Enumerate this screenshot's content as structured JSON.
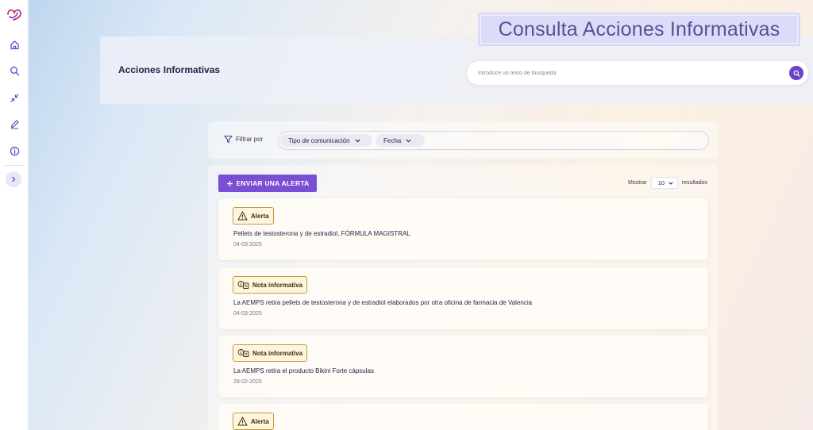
{
  "app": {
    "title": "Consulta Acciones Informativas"
  },
  "sidebar": {
    "items": [
      {
        "name": "home",
        "icon": "home-icon"
      },
      {
        "name": "search",
        "icon": "search-icon"
      },
      {
        "name": "collapse",
        "icon": "minimize-arrows-icon"
      },
      {
        "name": "edit",
        "icon": "pencil-icon"
      },
      {
        "name": "info",
        "icon": "info-icon"
      }
    ],
    "expand_icon": "chevron-right-icon"
  },
  "header": {
    "page_title": "Acciones Informativas",
    "search": {
      "placeholder": "Introduce un texto de busqueda",
      "value": ""
    }
  },
  "filters": {
    "label": "Filtrar por",
    "chips": [
      {
        "label": "Tipo de comunicación"
      },
      {
        "label": "Fecha"
      }
    ]
  },
  "toolbar": {
    "send_label": "ENVIAR UNA ALERTA",
    "show_label": "Mostrar",
    "show_value": "10",
    "results_label": "resultados"
  },
  "items": [
    {
      "type": "Alerta",
      "icon": "warning-triangle-icon",
      "title": "Pellets de testosterona y de estradiol, FÓRMULA MAGISTRAL",
      "date": "04-03-2025"
    },
    {
      "type": "Nota informativa",
      "icon": "info-note-icon",
      "title": "La AEMPS retira pellets de testosterona y de estradiol elaborados por otra oficina de farmacia de Valencia",
      "date": "04-03-2025"
    },
    {
      "type": "Nota informativa",
      "icon": "info-note-icon",
      "title": "La AEMPS retira el producto Bikini Forte cápsulas",
      "date": "28-02-2025"
    },
    {
      "type": "Alerta",
      "icon": "warning-triangle-icon",
      "title": "",
      "date": ""
    }
  ],
  "colors": {
    "accent": "#7a4fd4",
    "badge_border": "#c49a3e",
    "badge_bg": "#fdf6dc",
    "title_text": "#5a4f96"
  }
}
